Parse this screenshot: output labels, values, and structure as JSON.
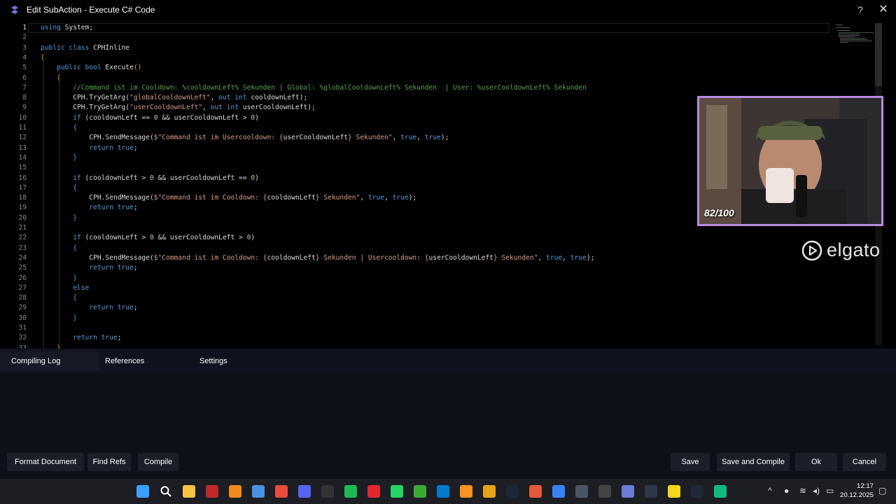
{
  "window": {
    "title": "Edit SubAction - Execute C# Code",
    "help": "?",
    "close": "✕"
  },
  "editor": {
    "lines": [
      {
        "n": "1",
        "html": "<span class=\"kw\">using</span> System;"
      },
      {
        "n": "2",
        "html": ""
      },
      {
        "n": "3",
        "html": "<span class=\"kw\">public class</span> CPHInline"
      },
      {
        "n": "4",
        "html": "<span class=\"br\">{</span>"
      },
      {
        "n": "5",
        "html": "    <span class=\"kw\">public bool</span> Execute<span class=\"br\">()</span>"
      },
      {
        "n": "6",
        "html": "    <span class=\"br\">{</span>"
      },
      {
        "n": "7",
        "html": "        <span class=\"cm\">//Command ist im Cooldown: %cooldownLeft% Sekunden | Global: %globalCooldownLeft% Sekunden  | User: %userCooldownLeft% Sekunden</span>"
      },
      {
        "n": "8",
        "html": "        CPH.TryGetArg(<span class=\"str\">\"globalCooldownLeft\"</span>, <span class=\"kw\">out int</span> cooldownLeft);"
      },
      {
        "n": "9",
        "html": "        CPH.TryGetArg(<span class=\"str\">\"userCooldownLeft\"</span>, <span class=\"kw\">out int</span> userCooldownLeft);"
      },
      {
        "n": "10",
        "html": "        <span class=\"kw\">if</span> (cooldownLeft == <span class=\"nm\">0</span> &amp;&amp; userCooldownLeft &gt; <span class=\"nm\">0</span>)"
      },
      {
        "n": "11",
        "html": "        <span class=\"kw\">{</span>"
      },
      {
        "n": "12",
        "html": "            CPH.SendMessage(<span class=\"str\">$\"Command ist im Usercooldown: {</span>userCooldownLeft<span class=\"str\">} Sekunden\"</span>, <span class=\"kw\">true</span>, <span class=\"kw\">true</span>);"
      },
      {
        "n": "13",
        "html": "            <span class=\"kw\">return true</span>;"
      },
      {
        "n": "14",
        "html": "        <span class=\"kw\">}</span>"
      },
      {
        "n": "15",
        "html": ""
      },
      {
        "n": "16",
        "html": "        <span class=\"kw\">if</span> (cooldownLeft &gt; <span class=\"nm\">0</span> &amp;&amp; userCooldownLeft == <span class=\"nm\">0</span>)"
      },
      {
        "n": "17",
        "html": "        <span class=\"kw\">{</span>"
      },
      {
        "n": "18",
        "html": "            CPH.SendMessage(<span class=\"str\">$\"Command ist im Cooldown: {</span>cooldownLeft<span class=\"str\">} Sekunden\"</span>, <span class=\"kw\">true</span>, <span class=\"kw\">true</span>);"
      },
      {
        "n": "19",
        "html": "            <span class=\"kw\">return true</span>;"
      },
      {
        "n": "20",
        "html": "        <span class=\"kw\">}</span>"
      },
      {
        "n": "21",
        "html": ""
      },
      {
        "n": "22",
        "html": "        <span class=\"kw\">if</span> (cooldownLeft &gt; <span class=\"nm\">0</span> &amp;&amp; userCooldownLeft &gt; <span class=\"nm\">0</span>)"
      },
      {
        "n": "23",
        "html": "        <span class=\"kw\">{</span>"
      },
      {
        "n": "24",
        "html": "            CPH.SendMessage(<span class=\"str\">$\"Command ist im Cooldown: {</span>cooldownLeft<span class=\"str\">} Sekunden | Usercooldown: {</span>userCooldownLeft<span class=\"str\">} Sekunden\"</span>, <span class=\"kw\">true</span>, <span class=\"kw\">true</span>);"
      },
      {
        "n": "25",
        "html": "            <span class=\"kw\">return true</span>;"
      },
      {
        "n": "26",
        "html": "        <span class=\"kw\">}</span>"
      },
      {
        "n": "27",
        "html": "        <span class=\"kw\">else</span>"
      },
      {
        "n": "28",
        "html": "        <span class=\"kw\">{</span>"
      },
      {
        "n": "29",
        "html": "            <span class=\"kw\">return true</span>;"
      },
      {
        "n": "30",
        "html": "        <span class=\"kw\">}</span>"
      },
      {
        "n": "31",
        "html": ""
      },
      {
        "n": "32",
        "html": "        <span class=\"kw\">return true</span>;"
      },
      {
        "n": "33",
        "html": "    <span class=\"br\">}</span>"
      }
    ]
  },
  "webcam": {
    "overlay_text": "82/100",
    "brand": "elgato"
  },
  "bottom_panel": {
    "tabs": [
      "Compiling Log",
      "References",
      "Settings"
    ],
    "buttons_left": [
      "Format Document",
      "Find Refs",
      "Compile"
    ],
    "buttons_right": [
      "Save",
      "Save and Compile",
      "Ok",
      "Cancel"
    ]
  },
  "taskbar": {
    "icons": [
      "windows-start-icon",
      "search-icon",
      "file-explorer-icon",
      "filezilla-icon",
      "vlc-icon",
      "chrome-icon",
      "chrome-alt-icon",
      "discord-icon",
      "epic-games-icon",
      "spotify-icon",
      "red-diamond-icon",
      "whatsapp-icon",
      "green-app-icon",
      "vscode-icon",
      "orange-app-icon",
      "r-app-icon",
      "steam-icon",
      "tools-icon",
      "drop-icon",
      "network-app-icon",
      "obs-icon",
      "streamerbot-icon",
      "davinci-icon",
      "sticky-notes-icon",
      "audio-app-icon",
      "green-square-icon"
    ],
    "time": "12:17",
    "date": "20.12.2025"
  }
}
